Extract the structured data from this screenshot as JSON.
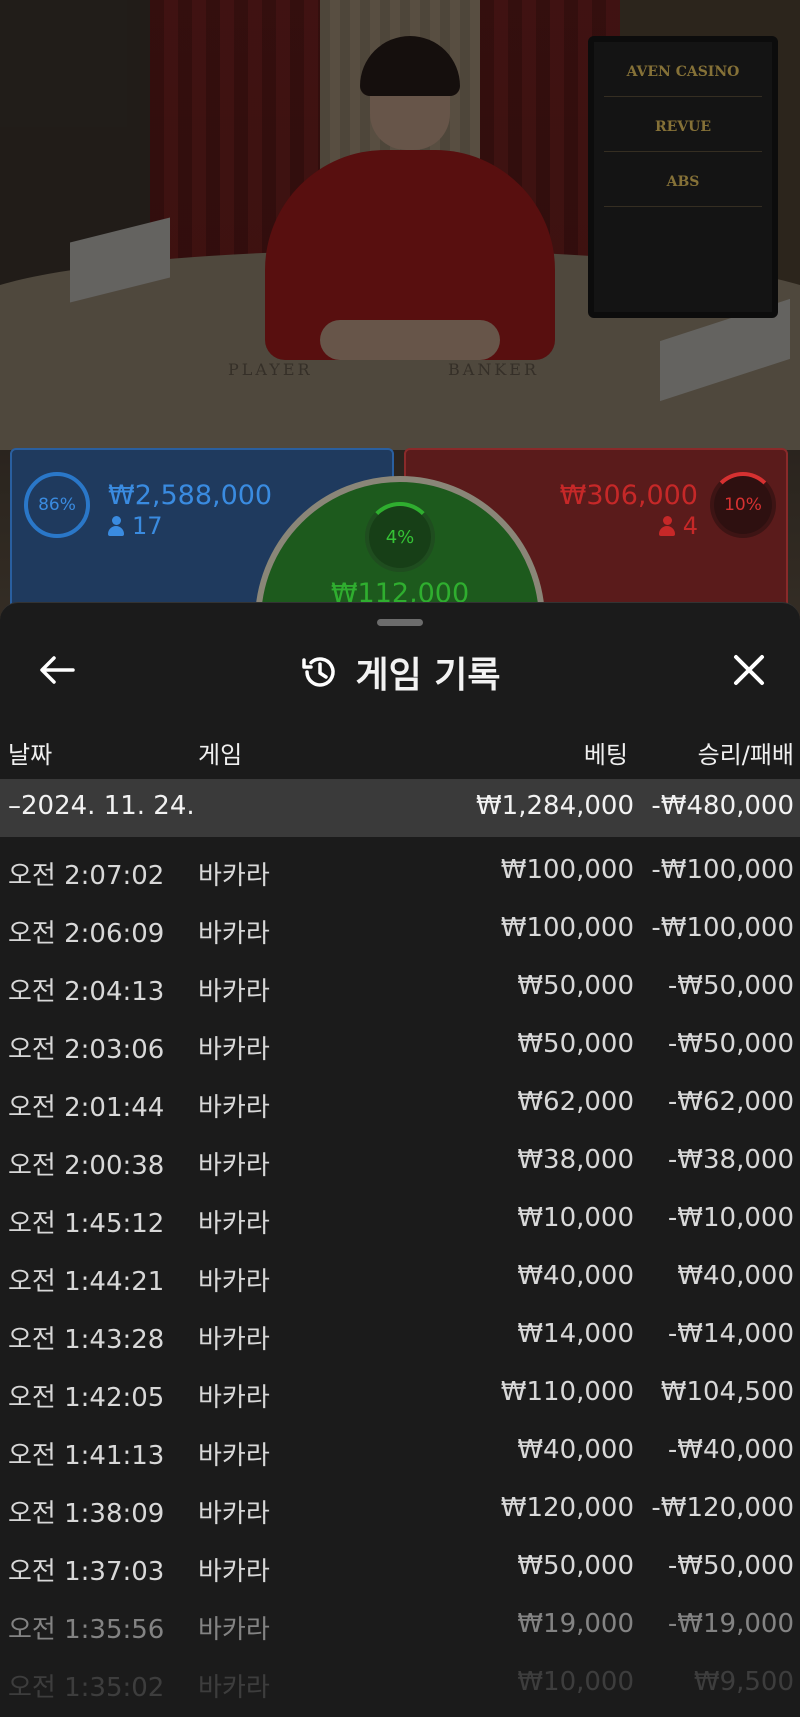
{
  "stream": {
    "table_labels": [
      "PLAYER",
      "BANKER"
    ],
    "screen_brands": [
      "AVEN CASINO",
      "REVUE",
      "ABS"
    ]
  },
  "bets": {
    "player": {
      "percent": "86%",
      "amount": "₩2,588,000",
      "players": "17",
      "color": "#2a77c8"
    },
    "tie": {
      "percent": "4%",
      "amount": "₩112,000",
      "color": "#2fae2f"
    },
    "banker": {
      "percent": "10%",
      "amount": "₩306,000",
      "players": "4",
      "color": "#c62828"
    }
  },
  "history": {
    "title": "게임 기록",
    "back_icon": "arrow-left-icon",
    "history_icon": "history-clock-icon",
    "close_icon": "close-x-icon",
    "columns": {
      "date": "날짜",
      "game": "게임",
      "bet": "베팅",
      "win_loss": "승리/패배"
    },
    "summary": {
      "date": "–2024. 11. 24.",
      "bet": "₩1,284,000",
      "win_loss": "-₩480,000"
    },
    "rows": [
      {
        "time": "오전 2:07:02",
        "game": "바카라",
        "bet": "₩100,000",
        "win_loss": "-₩100,000"
      },
      {
        "time": "오전 2:06:09",
        "game": "바카라",
        "bet": "₩100,000",
        "win_loss": "-₩100,000"
      },
      {
        "time": "오전 2:04:13",
        "game": "바카라",
        "bet": "₩50,000",
        "win_loss": "-₩50,000"
      },
      {
        "time": "오전 2:03:06",
        "game": "바카라",
        "bet": "₩50,000",
        "win_loss": "-₩50,000"
      },
      {
        "time": "오전 2:01:44",
        "game": "바카라",
        "bet": "₩62,000",
        "win_loss": "-₩62,000"
      },
      {
        "time": "오전 2:00:38",
        "game": "바카라",
        "bet": "₩38,000",
        "win_loss": "-₩38,000"
      },
      {
        "time": "오전 1:45:12",
        "game": "바카라",
        "bet": "₩10,000",
        "win_loss": "-₩10,000"
      },
      {
        "time": "오전 1:44:21",
        "game": "바카라",
        "bet": "₩40,000",
        "win_loss": "₩40,000"
      },
      {
        "time": "오전 1:43:28",
        "game": "바카라",
        "bet": "₩14,000",
        "win_loss": "-₩14,000"
      },
      {
        "time": "오전 1:42:05",
        "game": "바카라",
        "bet": "₩110,000",
        "win_loss": "₩104,500"
      },
      {
        "time": "오전 1:41:13",
        "game": "바카라",
        "bet": "₩40,000",
        "win_loss": "-₩40,000"
      },
      {
        "time": "오전 1:38:09",
        "game": "바카라",
        "bet": "₩120,000",
        "win_loss": "-₩120,000"
      },
      {
        "time": "오전 1:37:03",
        "game": "바카라",
        "bet": "₩50,000",
        "win_loss": "-₩50,000"
      },
      {
        "time": "오전 1:35:56",
        "game": "바카라",
        "bet": "₩19,000",
        "win_loss": "-₩19,000"
      },
      {
        "time": "오전 1:35:02",
        "game": "바카라",
        "bet": "₩10,000",
        "win_loss": "₩9,500"
      }
    ]
  }
}
